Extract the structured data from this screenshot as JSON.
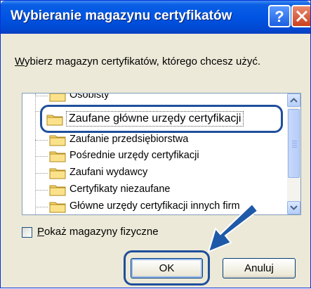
{
  "window": {
    "title": "Wybieranie magazynu certyfikatów",
    "help_icon": "help-icon",
    "close_icon": "close-icon"
  },
  "instruction": {
    "underlined_letter": "W",
    "rest": "ybierz magazyn certyfikatów, którego chcesz użyć."
  },
  "tree": {
    "items": [
      {
        "label": "Osobisty",
        "icon": "folder-icon"
      },
      {
        "label": "Zaufane główne urzędy certyfikacji",
        "icon": "folder-icon",
        "selected": true
      },
      {
        "label": "Zaufanie przedsiębiorstwa",
        "icon": "folder-icon"
      },
      {
        "label": "Pośrednie urzędy certyfikacji",
        "icon": "folder-icon"
      },
      {
        "label": "Zaufani wydawcy",
        "icon": "folder-icon"
      },
      {
        "label": "Certyfikaty niezaufane",
        "icon": "folder-icon"
      },
      {
        "label": "Główne urzędy certyfikacji innych firm",
        "icon": "folder-icon"
      }
    ]
  },
  "checkbox": {
    "underlined_letter": "P",
    "rest": "okaż magazyny fizyczne",
    "checked": false
  },
  "buttons": {
    "ok": "OK",
    "cancel": "Anuluj"
  },
  "colors": {
    "titlebar": "#0054e3",
    "callout_border": "#1e4f9b",
    "arrow": "#1e5aa8",
    "dialog_bg": "#ece9d8"
  }
}
